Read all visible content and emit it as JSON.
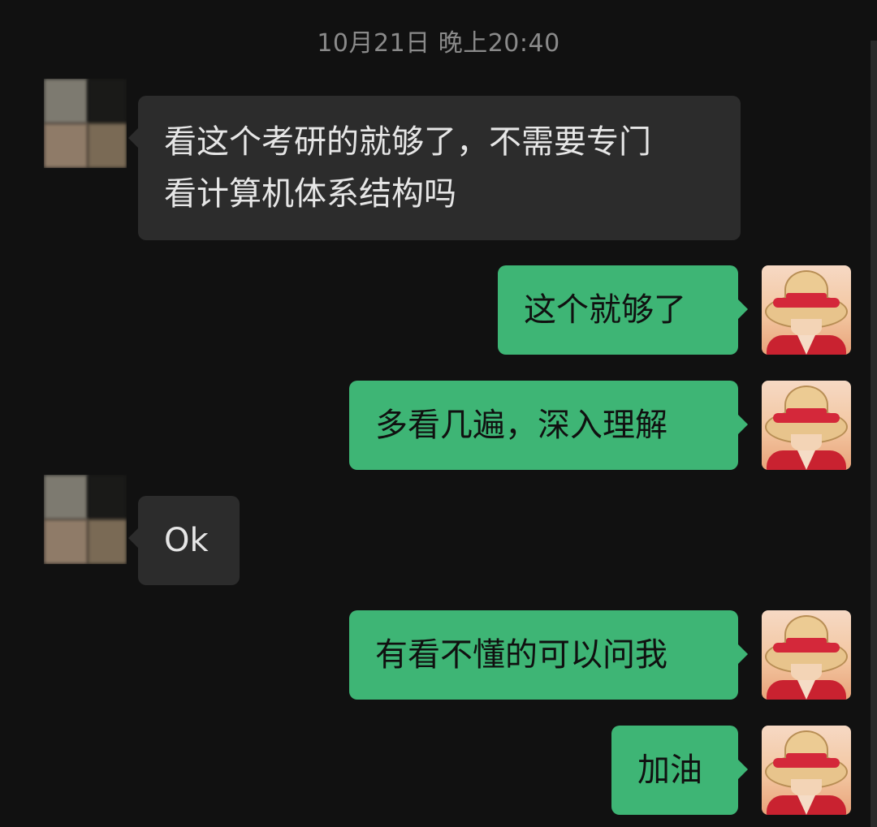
{
  "chat": {
    "timestamp": "10月21日 晚上20:40",
    "messages": [
      {
        "sender": "other",
        "text": "看这个考研的就够了，不需要专门\n看计算机体系结构吗",
        "avatar": "blurred-avatar"
      },
      {
        "sender": "me",
        "text": "这个就够了",
        "avatar": "straw-hat-avatar"
      },
      {
        "sender": "me",
        "text": "多看几遍，深入理解",
        "avatar": "straw-hat-avatar"
      },
      {
        "sender": "other",
        "text": "Ok",
        "avatar": "blurred-avatar"
      },
      {
        "sender": "me",
        "text": "有看不懂的可以问我",
        "avatar": "straw-hat-avatar"
      },
      {
        "sender": "me",
        "text": "加油",
        "avatar": "straw-hat-avatar"
      }
    ]
  },
  "colors": {
    "background": "#111111",
    "incoming_bubble": "#2c2c2c",
    "outgoing_bubble": "#3eb575",
    "timestamp_text": "#8a8a8a"
  }
}
